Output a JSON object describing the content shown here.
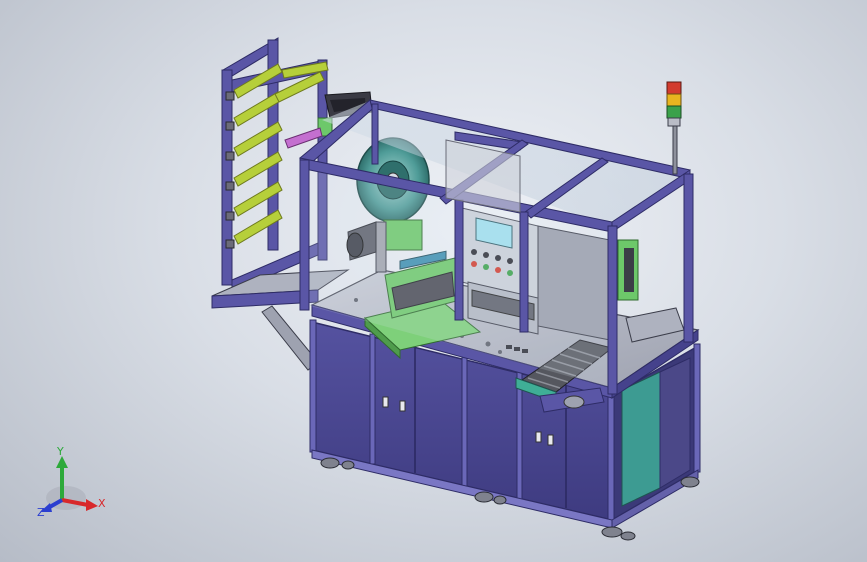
{
  "viewport": {
    "background_top": "#eef1f6",
    "background_bottom": "#b6bcc7"
  },
  "model": {
    "frame_color": "#5a56a6",
    "cabinet_color": "#4a4790",
    "cabinet_edge": "#2e2c66",
    "plate_color": "#b8bcc8",
    "roller_color": "#b6cf3a",
    "fixture_green": "#6dc86a",
    "conveyor_color": "#4a4a54",
    "glass_color": "#c6d4e2",
    "tower_lights": [
      "#d23b2e",
      "#e8b51f",
      "#3aa14a"
    ]
  },
  "triad": {
    "x_label": "X",
    "y_label": "Y",
    "z_label": "Z",
    "x_color": "#d8282b",
    "y_color": "#2da93a",
    "z_color": "#2b3fd0"
  }
}
